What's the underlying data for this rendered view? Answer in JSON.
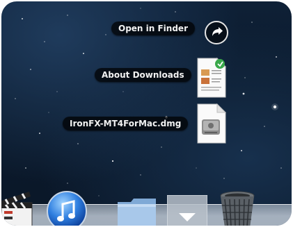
{
  "stack": {
    "items": [
      {
        "label": "Open in Finder",
        "icon": "arrow-circle-icon"
      },
      {
        "label": "About Downloads",
        "icon": "rtf-document-icon"
      },
      {
        "label": "IronFX-MT4ForMac.dmg",
        "icon": "disk-image-icon"
      }
    ]
  },
  "dock": {
    "items": [
      {
        "icon": "clapper-icon"
      },
      {
        "icon": "itunes-icon"
      },
      {
        "icon": "folder-icon"
      },
      {
        "icon": "downloads-stack-icon"
      },
      {
        "icon": "trash-icon"
      }
    ]
  },
  "colors": {
    "background": "#0b1a2c",
    "label_bg": "#000000",
    "label_text": "#f2f2f2",
    "itunes_blue": "#2f7fe0"
  }
}
